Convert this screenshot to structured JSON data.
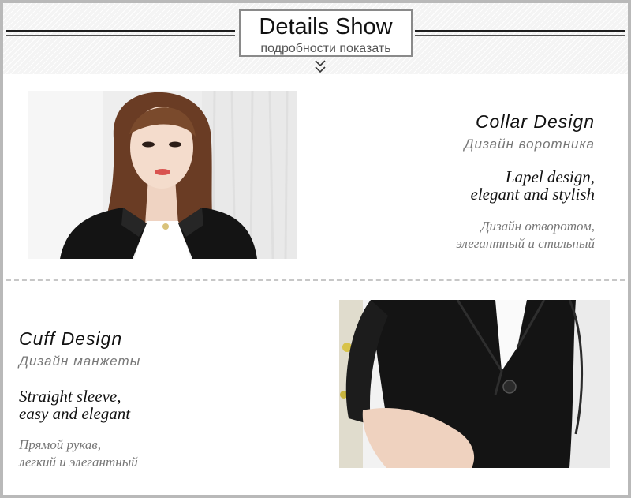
{
  "header": {
    "title": "Details Show",
    "subtitle": "подробности показать"
  },
  "sections": [
    {
      "heading": "Collar Design",
      "heading_ru": "Дизайн воротника",
      "desc_line1": "Lapel design,",
      "desc_line2": "elegant and stylish",
      "desc_ru_line1": "Дизайн отворотом,",
      "desc_ru_line2": "элегантный и стильный"
    },
    {
      "heading": "Cuff Design",
      "heading_ru": "Дизайн манжеты",
      "desc_line1": "Straight sleeve,",
      "desc_line2": "easy and elegant",
      "desc_ru_line1": "Прямой рукав,",
      "desc_ru_line2": "легкий и элегантный"
    }
  ],
  "colors": {
    "jacket": "#141414",
    "frame": "#b9b9b9",
    "divider": "#c7c7c7"
  }
}
